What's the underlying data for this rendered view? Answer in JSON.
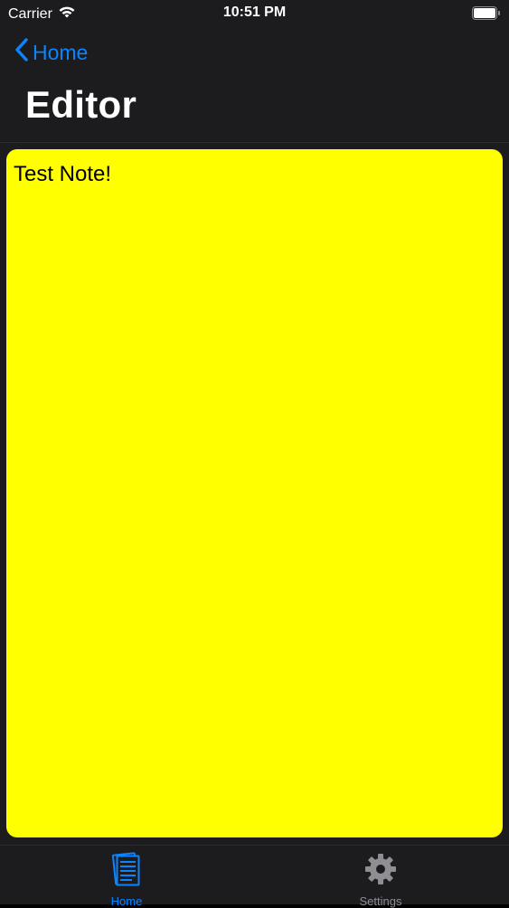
{
  "status_bar": {
    "carrier": "Carrier",
    "time": "10:51 PM"
  },
  "nav": {
    "back_label": "Home",
    "title": "Editor"
  },
  "editor": {
    "text": "Test Note!",
    "background_color": "#ffff00"
  },
  "tabs": [
    {
      "label": "Home",
      "icon": "notes-icon",
      "selected": true
    },
    {
      "label": "Settings",
      "icon": "gear-icon",
      "selected": false
    }
  ],
  "colors": {
    "accent": "#0a84ff",
    "inactive": "#8e8e93",
    "bar_background": "#1c1c1e"
  }
}
